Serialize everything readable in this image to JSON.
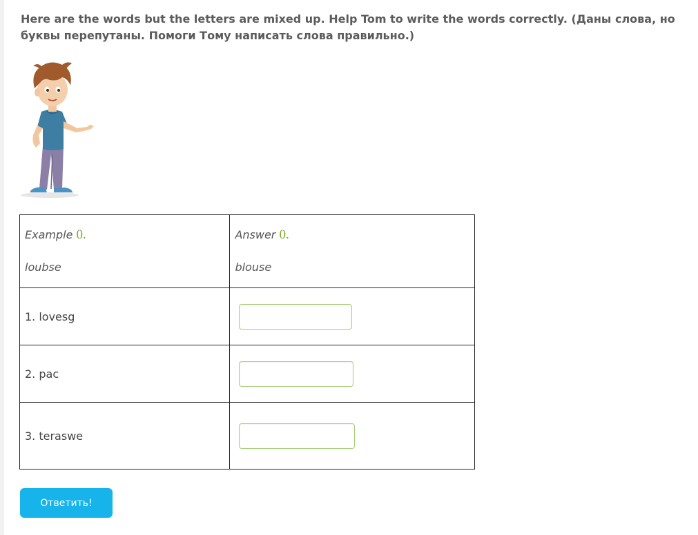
{
  "task": {
    "instruction": "Here are the words but the letters are mixed up. Help Tom to write the words correctly. (Даны слова, но буквы перепутаны. Помоги Тому написать слова правильно.)"
  },
  "table": {
    "example": {
      "label_word": "Example",
      "label_number": "0.",
      "scrambled": "loubse",
      "answer_label_word": "Answer",
      "answer_label_number": "0.",
      "answer": "blouse"
    },
    "rows": [
      {
        "item": "1. lovesg",
        "answer_value": ""
      },
      {
        "item": "2. pac",
        "answer_value": ""
      },
      {
        "item": "3. teraswe",
        "answer_value": ""
      }
    ]
  },
  "submit": {
    "label": "Ответить!"
  },
  "colors": {
    "accent_green": "#7cab2d",
    "button_blue": "#16b4ea",
    "input_border": "#a9cd7b"
  }
}
